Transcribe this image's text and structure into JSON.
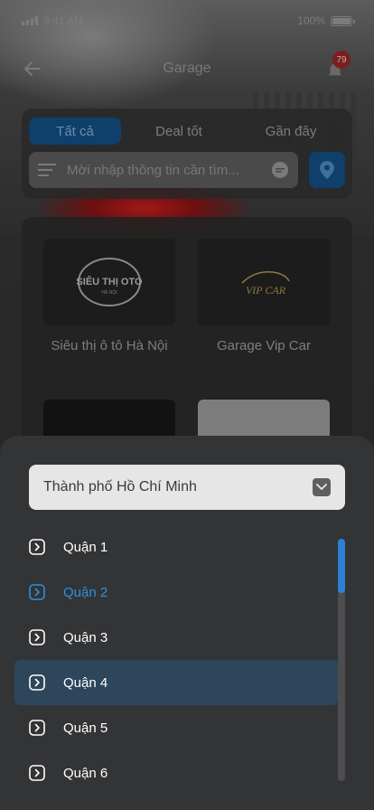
{
  "status_bar": {
    "time": "9:41 AM",
    "battery": "100%",
    "battery_level": 1.0
  },
  "header": {
    "title": "Garage",
    "notification_count": "79"
  },
  "tabs": [
    {
      "label": "Tất cả",
      "active": true
    },
    {
      "label": "Deal tốt",
      "active": false
    },
    {
      "label": "Gần đây",
      "active": false
    }
  ],
  "search": {
    "placeholder": "Mời nhập thông tin cần tìm..."
  },
  "garages": [
    {
      "name": "Siêu thị ô tô Hà Nội",
      "logo_text": "SIÊU THỊ OTO",
      "logo_subtext": "HÀ NỘI"
    },
    {
      "name": "Garage Vip Car",
      "logo_text": "VIP CAR"
    },
    {
      "name": ""
    },
    {
      "name": ""
    }
  ],
  "city_select": {
    "value": "Thành phố Hồ Chí Minh"
  },
  "districts": [
    {
      "label": "Quận 1",
      "state": "normal"
    },
    {
      "label": "Quận 2",
      "state": "selected"
    },
    {
      "label": "Quận 3",
      "state": "normal"
    },
    {
      "label": "Quận 4",
      "state": "highlight"
    },
    {
      "label": "Quận 5",
      "state": "normal"
    },
    {
      "label": "Quận 6",
      "state": "normal"
    }
  ],
  "colors": {
    "accent": "#2f8fe0",
    "highlight_row": "#2d465c",
    "sheet_bg": "#333436"
  }
}
